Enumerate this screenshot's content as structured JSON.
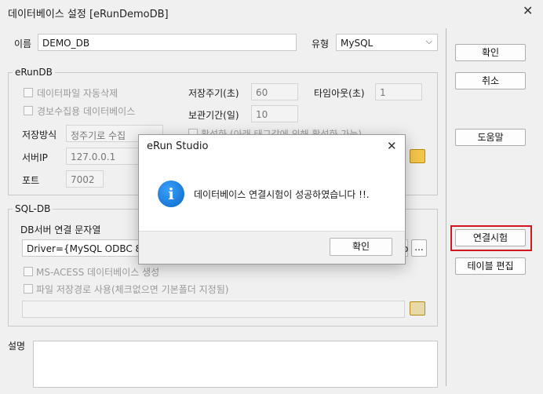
{
  "window": {
    "title": "데이터베이스 설정 [eRunDemoDB]",
    "close_glyph": "✕"
  },
  "top": {
    "name_label": "이름",
    "name_value": "DEMO_DB",
    "type_label": "유형",
    "type_value": "MySQL",
    "arrow": "⌵"
  },
  "erundb": {
    "group_title": "eRunDB",
    "auto_delete_label": "데이터파일 자동삭제",
    "alarm_db_label": "경보수집용 데이터베이스",
    "save_period_label": "저장주기(초)",
    "save_period_value": "60",
    "timeout_label": "타임아웃(초)",
    "timeout_value": "1",
    "retention_label": "보관기간(일)",
    "retention_value": "10",
    "save_mode_label": "저장방식",
    "save_mode_value": "정주기로 수집",
    "activate_label": "활성화 (아래 태그값에 의해 활성화 가능)",
    "server_ip_label": "서버IP",
    "server_ip_value": "127.0.0.1",
    "port_label": "포트",
    "port_value": "7002"
  },
  "sqldb": {
    "group_title": "SQL-DB",
    "conn_string_label": "DB서버 연결 문자열",
    "conn_string_value": "Driver={MySQL ODBC 8.0 A",
    "conn_string_tail": "o",
    "browse_label": "...",
    "msaccess_label": "MS-ACESS 데이터베이스 생성",
    "file_path_label": "파일 저장경로 사용(체크없으면 기본폴더 지정됨)",
    "path_value": ""
  },
  "description": {
    "label": "설명",
    "value": ""
  },
  "buttons": {
    "ok": "확인",
    "cancel": "취소",
    "help": "도움말",
    "test_connection": "연결시험",
    "edit_table": "테이블 편집"
  },
  "dialog": {
    "title": "eRun Studio",
    "close_glyph": "✕",
    "message": "데이터베이스 연결시험이 성공하였습니다 !!.",
    "ok": "확인",
    "icon_glyph": "i"
  },
  "colors": {
    "highlight": "#d3171e",
    "info_icon": "#0b67c7"
  }
}
